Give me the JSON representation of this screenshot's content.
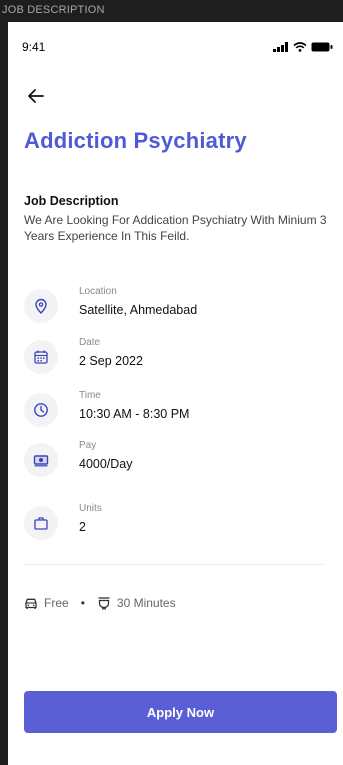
{
  "frame": {
    "label": "JOB DESCRIPTION"
  },
  "status_bar": {
    "time": "9:41",
    "icons": [
      "signal-icon",
      "wifi-icon",
      "battery-icon"
    ]
  },
  "header": {
    "back_icon": "back-arrow-icon",
    "title": "Addiction Psychiatry"
  },
  "job_description": {
    "heading": "Job Description",
    "text": "We Are Looking For  Addication Psychiatry With Minium 3 Years Experience In This Feild."
  },
  "details": [
    {
      "icon": "location-pin-icon",
      "label": "Location",
      "value": "Satellite, Ahmedabad"
    },
    {
      "icon": "calendar-icon",
      "label": "Date",
      "value": "2 Sep 2022"
    },
    {
      "icon": "clock-icon",
      "label": "Time",
      "value": "10:30 AM - 8:30 PM"
    },
    {
      "icon": "money-icon",
      "label": "Pay",
      "value": "4000/Day"
    },
    {
      "icon": "briefcase-icon",
      "label": "Units",
      "value": "2"
    }
  ],
  "meta": {
    "transport_icon": "car-icon",
    "transport": "Free",
    "separator": "•",
    "meal_icon": "food-icon",
    "duration": "30 Minutes"
  },
  "apply_button": {
    "label": "Apply Now"
  },
  "colors": {
    "accent": "#4f5bd5",
    "button": "#5b5fd6",
    "icon_stroke": "#3b44b8"
  }
}
